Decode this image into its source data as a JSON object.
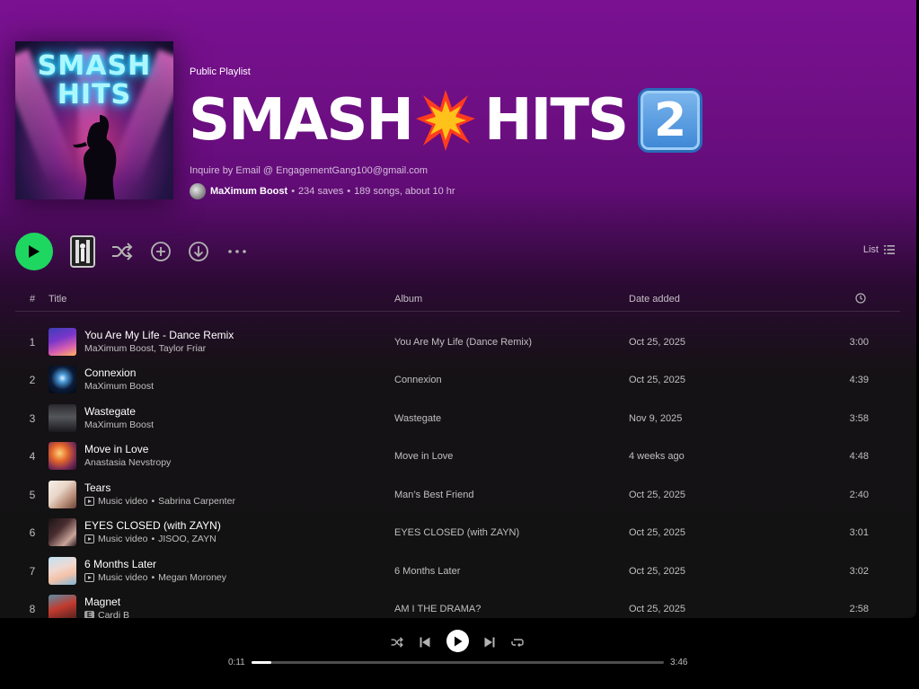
{
  "colors": {
    "accent": "#1ed760",
    "header_top": "#7a1191",
    "background": "#121212"
  },
  "cover": {
    "title": "SMASH HITS"
  },
  "playlist": {
    "type": "Public Playlist",
    "title_part1": "SMASH",
    "title_emoji1": "collision-emoji",
    "title_part2": "HITS",
    "title_keycap": "2",
    "description": "Inquire by Email @ EngagementGang100@gmail.com",
    "owner": "MaXimum Boost",
    "saves": "234 saves",
    "summary": "189 songs, about 10 hr"
  },
  "actions": {
    "play_icon": "play-icon",
    "shuffle_icon": "shuffle-icon",
    "add_icon": "add-circle-icon",
    "download_icon": "download-icon",
    "more_icon": "more-icon",
    "view_label": "List"
  },
  "table": {
    "headers": {
      "num": "#",
      "title": "Title",
      "album": "Album",
      "date": "Date added",
      "duration_icon": "clock-icon"
    },
    "tracks": [
      {
        "num": "1",
        "title": "You Are My Life - Dance Remix",
        "subtitle": "MaXimum Boost, Taylor Friar",
        "album": "You Are My Life (Dance Remix)",
        "date": "Oct 25, 2025",
        "duration": "3:00"
      },
      {
        "num": "2",
        "title": "Connexion",
        "subtitle": "MaXimum Boost",
        "album": "Connexion",
        "date": "Oct 25, 2025",
        "duration": "4:39"
      },
      {
        "num": "3",
        "title": "Wastegate",
        "subtitle": "MaXimum Boost",
        "album": "Wastegate",
        "date": "Nov 9, 2025",
        "duration": "3:58"
      },
      {
        "num": "4",
        "title": "Move in Love",
        "subtitle": "Anastasia Nevstropy",
        "album": "Move in Love",
        "date": "4 weeks ago",
        "duration": "4:48"
      },
      {
        "num": "5",
        "title": "Tears",
        "mv_label": "Music video",
        "subtitle": "Sabrina Carpenter",
        "album": "Man’s Best Friend",
        "date": "Oct 25, 2025",
        "duration": "2:40"
      },
      {
        "num": "6",
        "title": "EYES CLOSED (with ZAYN)",
        "mv_label": "Music video",
        "subtitle": "JISOO, ZAYN",
        "album": "EYES CLOSED (with ZAYN)",
        "date": "Oct 25, 2025",
        "duration": "3:01"
      },
      {
        "num": "7",
        "title": "6 Months Later",
        "mv_label": "Music video",
        "subtitle": "Megan Moroney",
        "album": "6 Months Later",
        "date": "Oct 25, 2025",
        "duration": "3:02"
      },
      {
        "num": "8",
        "title": "Magnet",
        "explicit": "E",
        "subtitle": "Cardi B",
        "album": "AM I THE DRAMA?",
        "date": "Oct 25, 2025",
        "duration": "2:58"
      }
    ]
  },
  "player": {
    "elapsed": "0:11",
    "total": "3:46",
    "progress": 0.049,
    "icons": [
      "shuffle-icon",
      "previous-icon",
      "play-icon",
      "next-icon",
      "repeat-icon"
    ]
  }
}
